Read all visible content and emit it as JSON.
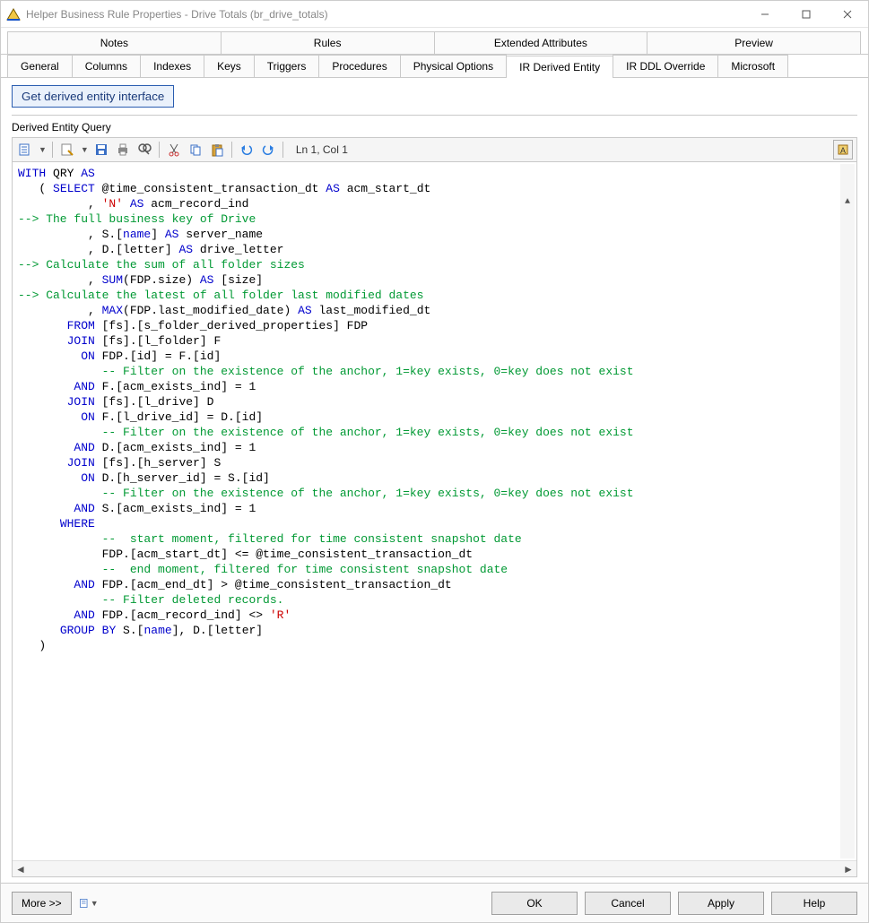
{
  "window": {
    "title": "Helper Business Rule Properties - Drive Totals (br_drive_totals)"
  },
  "tabrow1": [
    "Notes",
    "Rules",
    "Extended Attributes",
    "Preview"
  ],
  "tabrow2": [
    "General",
    "Columns",
    "Indexes",
    "Keys",
    "Triggers",
    "Procedures",
    "Physical Options",
    "IR Derived Entity",
    "IR DDL Override",
    "Microsoft"
  ],
  "active_tab2": "IR Derived Entity",
  "get_button": "Get derived entity interface",
  "section_label": "Derived Entity Query",
  "editor_status": "Ln 1, Col 1",
  "footer": {
    "more": "More >>",
    "ok": "OK",
    "cancel": "Cancel",
    "apply": "Apply",
    "help": "Help"
  },
  "code_lines": [
    [
      {
        "c": "kw",
        "t": "WITH"
      },
      {
        "c": "plain",
        "t": " QRY "
      },
      {
        "c": "kw",
        "t": "AS"
      }
    ],
    [
      {
        "c": "plain",
        "t": "   ( "
      },
      {
        "c": "kw",
        "t": "SELECT"
      },
      {
        "c": "plain",
        "t": " @time_consistent_transaction_dt "
      },
      {
        "c": "kw",
        "t": "AS"
      },
      {
        "c": "plain",
        "t": " acm_start_dt"
      }
    ],
    [
      {
        "c": "plain",
        "t": "          , "
      },
      {
        "c": "str",
        "t": "'N'"
      },
      {
        "c": "plain",
        "t": " "
      },
      {
        "c": "kw",
        "t": "AS"
      },
      {
        "c": "plain",
        "t": " acm_record_ind"
      }
    ],
    [
      {
        "c": "cm",
        "t": "--> The full business key of Drive"
      }
    ],
    [
      {
        "c": "plain",
        "t": "          , S.["
      },
      {
        "c": "kw",
        "t": "name"
      },
      {
        "c": "plain",
        "t": "] "
      },
      {
        "c": "kw",
        "t": "AS"
      },
      {
        "c": "plain",
        "t": " server_name"
      }
    ],
    [
      {
        "c": "plain",
        "t": "          , D.[letter] "
      },
      {
        "c": "kw",
        "t": "AS"
      },
      {
        "c": "plain",
        "t": " drive_letter"
      }
    ],
    [
      {
        "c": "cm",
        "t": "--> Calculate the sum of all folder sizes"
      }
    ],
    [
      {
        "c": "plain",
        "t": "          , "
      },
      {
        "c": "kw",
        "t": "SUM"
      },
      {
        "c": "plain",
        "t": "(FDP.size) "
      },
      {
        "c": "kw",
        "t": "AS"
      },
      {
        "c": "plain",
        "t": " [size]"
      }
    ],
    [
      {
        "c": "cm",
        "t": "--> Calculate the latest of all folder last modified dates"
      }
    ],
    [
      {
        "c": "plain",
        "t": "          , "
      },
      {
        "c": "kw",
        "t": "MAX"
      },
      {
        "c": "plain",
        "t": "(FDP.last_modified_date) "
      },
      {
        "c": "kw",
        "t": "AS"
      },
      {
        "c": "plain",
        "t": " last_modified_dt"
      }
    ],
    [
      {
        "c": "plain",
        "t": "       "
      },
      {
        "c": "kw",
        "t": "FROM"
      },
      {
        "c": "plain",
        "t": " [fs].[s_folder_derived_properties] FDP"
      }
    ],
    [
      {
        "c": "plain",
        "t": "       "
      },
      {
        "c": "kw",
        "t": "JOIN"
      },
      {
        "c": "plain",
        "t": " [fs].[l_folder] F"
      }
    ],
    [
      {
        "c": "plain",
        "t": "         "
      },
      {
        "c": "kw",
        "t": "ON"
      },
      {
        "c": "plain",
        "t": " FDP.[id] = F.[id]"
      }
    ],
    [
      {
        "c": "plain",
        "t": "            "
      },
      {
        "c": "cm",
        "t": "-- Filter on the existence of the anchor, 1=key exists, 0=key does not exist"
      }
    ],
    [
      {
        "c": "plain",
        "t": "        "
      },
      {
        "c": "kw",
        "t": "AND"
      },
      {
        "c": "plain",
        "t": " F.[acm_exists_ind] = 1"
      }
    ],
    [
      {
        "c": "plain",
        "t": "       "
      },
      {
        "c": "kw",
        "t": "JOIN"
      },
      {
        "c": "plain",
        "t": " [fs].[l_drive] D"
      }
    ],
    [
      {
        "c": "plain",
        "t": "         "
      },
      {
        "c": "kw",
        "t": "ON"
      },
      {
        "c": "plain",
        "t": " F.[l_drive_id] = D.[id]"
      }
    ],
    [
      {
        "c": "plain",
        "t": "            "
      },
      {
        "c": "cm",
        "t": "-- Filter on the existence of the anchor, 1=key exists, 0=key does not exist"
      }
    ],
    [
      {
        "c": "plain",
        "t": "        "
      },
      {
        "c": "kw",
        "t": "AND"
      },
      {
        "c": "plain",
        "t": " D.[acm_exists_ind] = 1"
      }
    ],
    [
      {
        "c": "plain",
        "t": "       "
      },
      {
        "c": "kw",
        "t": "JOIN"
      },
      {
        "c": "plain",
        "t": " [fs].[h_server] S"
      }
    ],
    [
      {
        "c": "plain",
        "t": "         "
      },
      {
        "c": "kw",
        "t": "ON"
      },
      {
        "c": "plain",
        "t": " D.[h_server_id] = S.[id]"
      }
    ],
    [
      {
        "c": "plain",
        "t": "            "
      },
      {
        "c": "cm",
        "t": "-- Filter on the existence of the anchor, 1=key exists, 0=key does not exist"
      }
    ],
    [
      {
        "c": "plain",
        "t": "        "
      },
      {
        "c": "kw",
        "t": "AND"
      },
      {
        "c": "plain",
        "t": " S.[acm_exists_ind] = 1"
      }
    ],
    [
      {
        "c": "plain",
        "t": "      "
      },
      {
        "c": "kw",
        "t": "WHERE"
      }
    ],
    [
      {
        "c": "plain",
        "t": "            "
      },
      {
        "c": "cm",
        "t": "--  start moment, filtered for time consistent snapshot date"
      }
    ],
    [
      {
        "c": "plain",
        "t": "            FDP.[acm_start_dt] <= @time_consistent_transaction_dt"
      }
    ],
    [
      {
        "c": "plain",
        "t": "            "
      },
      {
        "c": "cm",
        "t": "--  end moment, filtered for time consistent snapshot date"
      }
    ],
    [
      {
        "c": "plain",
        "t": "        "
      },
      {
        "c": "kw",
        "t": "AND"
      },
      {
        "c": "plain",
        "t": " FDP.[acm_end_dt] > @time_consistent_transaction_dt"
      }
    ],
    [
      {
        "c": "plain",
        "t": "            "
      },
      {
        "c": "cm",
        "t": "-- Filter deleted records."
      }
    ],
    [
      {
        "c": "plain",
        "t": "        "
      },
      {
        "c": "kw",
        "t": "AND"
      },
      {
        "c": "plain",
        "t": " FDP.[acm_record_ind] <> "
      },
      {
        "c": "str",
        "t": "'R'"
      }
    ],
    [
      {
        "c": "plain",
        "t": "      "
      },
      {
        "c": "kw",
        "t": "GROUP"
      },
      {
        "c": "plain",
        "t": " "
      },
      {
        "c": "kw",
        "t": "BY"
      },
      {
        "c": "plain",
        "t": " S.["
      },
      {
        "c": "kw",
        "t": "name"
      },
      {
        "c": "plain",
        "t": "], D.[letter]"
      }
    ],
    [
      {
        "c": "plain",
        "t": "   )"
      }
    ]
  ]
}
